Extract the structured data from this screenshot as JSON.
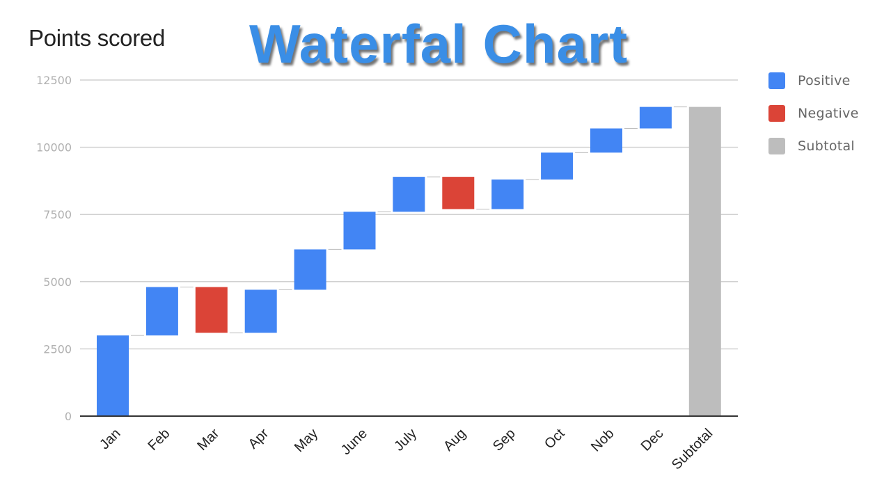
{
  "banner_title": "Waterfal Chart",
  "colors": {
    "positive": "#4285f4",
    "negative": "#db4437",
    "subtotal": "#bdbdbd",
    "gridline": "#d0d0d0",
    "axis": "#333333",
    "connector": "#bbbbbb"
  },
  "legend": [
    {
      "key": "positive",
      "label": "Positive",
      "color": "#4285f4"
    },
    {
      "key": "negative",
      "label": "Negative",
      "color": "#db4437"
    },
    {
      "key": "subtotal",
      "label": "Subtotal",
      "color": "#bdbdbd"
    }
  ],
  "chart_data": {
    "type": "bar",
    "subtype": "waterfall",
    "title": "Points scored",
    "xlabel": "",
    "ylabel": "",
    "ylim": [
      0,
      12500
    ],
    "yticks": [
      0,
      2500,
      5000,
      7500,
      10000,
      12500
    ],
    "grid": true,
    "legend_position": "right",
    "categories": [
      "Jan",
      "Feb",
      "Mar",
      "Apr",
      "May",
      "June",
      "July",
      "Aug",
      "Sep",
      "Oct",
      "Nob",
      "Dec",
      "Subtotal"
    ],
    "changes": [
      3000,
      1800,
      -1700,
      1600,
      1500,
      1400,
      1300,
      -1200,
      1100,
      1000,
      900,
      800,
      null
    ],
    "cumulative": [
      3000,
      4800,
      3100,
      4700,
      6200,
      7600,
      8900,
      7700,
      8800,
      9800,
      10700,
      11500,
      11500
    ],
    "kinds": [
      "positive",
      "positive",
      "negative",
      "positive",
      "positive",
      "positive",
      "positive",
      "negative",
      "positive",
      "positive",
      "positive",
      "positive",
      "subtotal"
    ]
  }
}
